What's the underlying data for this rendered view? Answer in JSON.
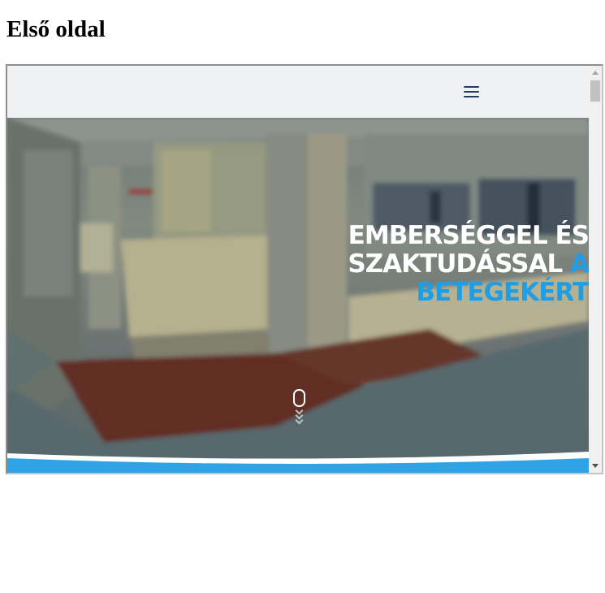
{
  "page": {
    "heading": "Első oldal"
  },
  "embedded_site": {
    "header": {
      "menu_icon": "hamburger-menu-icon",
      "menu_icon_color": "#1f3f68",
      "background": "#f0f1f3"
    },
    "hero": {
      "headline_white": "EMBERSÉGGEL ÉS SZAKTUDÁSSAL",
      "headline_blue_1": "A",
      "headline_blue_2": "BETEGEKÉRT",
      "accent_color": "#1f9ee6",
      "scroll_icon": "mouse-scroll-icon",
      "chevron_icon": "chevron-down-icon",
      "background_description_icon": "hospital-reception-photo"
    }
  }
}
